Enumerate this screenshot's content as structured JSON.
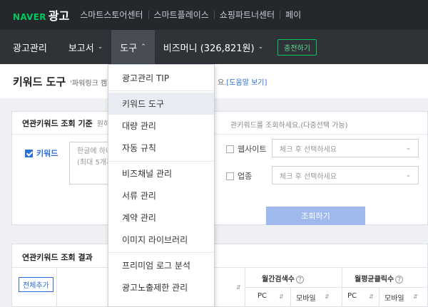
{
  "topbar": {
    "brand_naver": "NAVER",
    "brand_ad": "광고",
    "links": [
      "스마트스토어센터",
      "스마트플레이스",
      "쇼핑파트너센터",
      "페이"
    ]
  },
  "menubar": {
    "items": [
      {
        "label": "광고관리"
      },
      {
        "label": "보고서"
      },
      {
        "label": "도구"
      },
      {
        "label": "비즈머니 (326,821원)"
      }
    ],
    "charge_label": "충전하기"
  },
  "page": {
    "title": "키워드 도구",
    "desc": "'파워링크 캠페",
    "help_prefix": "요.",
    "help_link": "[도움말 보기]"
  },
  "panel1": {
    "title": "연관키워드 조회 기준",
    "note_left": "원하",
    "note_right": "관키워드를 조회하세요.(다중선택 가능)",
    "keyword_label": "키워드",
    "keyword_placeholder_l1": "한글에 하나",
    "keyword_placeholder_l2": "(최대 5개까",
    "website_label": "웹사이트",
    "website_placeholder": "체크 후 선택하세요",
    "industry_label": "업종",
    "industry_placeholder": "체크 후 선택하세요",
    "search_button": "조회하기"
  },
  "panel2": {
    "title": "연관키워드 조회 결과",
    "add_all": "전체추가",
    "monthly_search": "월간검색수",
    "monthly_clicks": "월평균클릭수",
    "pc": "PC",
    "mobile": "모바일",
    "help_glyph": "?"
  },
  "dropdown": {
    "items": [
      {
        "label": "광고관리 TIP"
      },
      {
        "label": "키워드 도구"
      },
      {
        "label": "대량 관리"
      },
      {
        "label": "자동 규칙"
      },
      {
        "label": "비즈채널 관리"
      },
      {
        "label": "서류 관리"
      },
      {
        "label": "계약 관리"
      },
      {
        "label": "이미지 라이브러리"
      },
      {
        "label": "프리미엄 로그 분석"
      },
      {
        "label": "광고노출제한 관리"
      }
    ]
  }
}
